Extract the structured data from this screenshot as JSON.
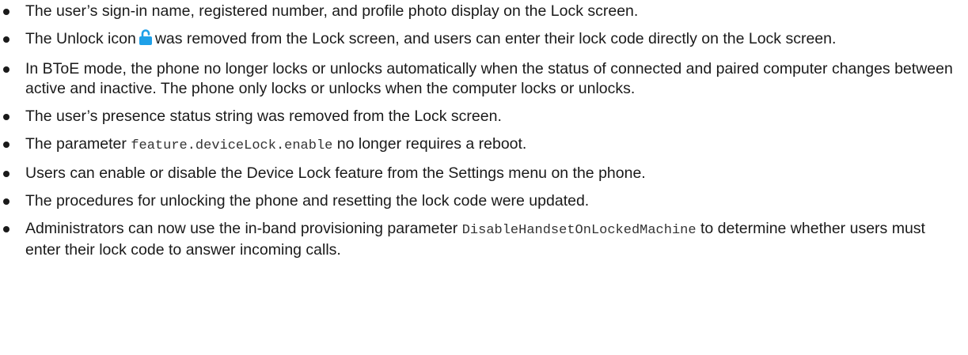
{
  "items": [
    {
      "text": "The user’s sign-in name, registered number, and profile photo display on the Lock screen."
    },
    {
      "before": "The Unlock icon",
      "icon": "unlock-padlock-icon",
      "after": "was removed from the Lock screen, and users can enter their lock code directly on the Lock screen."
    },
    {
      "text": "In BToE mode, the phone no longer locks or unlocks automatically when the status of connected and paired computer changes between active and inactive. The phone only locks or unlocks when the computer locks or unlocks."
    },
    {
      "text": "The user’s presence status string was removed from the Lock screen."
    },
    {
      "before": "The parameter ",
      "code": "feature.deviceLock.enable",
      "after": " no longer requires a reboot."
    },
    {
      "text": "Users can enable or disable the Device Lock feature from the Settings menu on the phone."
    },
    {
      "text": "The procedures for unlocking the phone and resetting the lock code were updated."
    },
    {
      "before": "Administrators can now use the in-band provisioning parameter ",
      "code": "DisableHandsetOnLockedMachine",
      "after": " to determine whether users must enter their lock code to answer incoming calls."
    }
  ],
  "colors": {
    "text": "#1a1a1a",
    "icon_blue": "#1ea0e8"
  }
}
